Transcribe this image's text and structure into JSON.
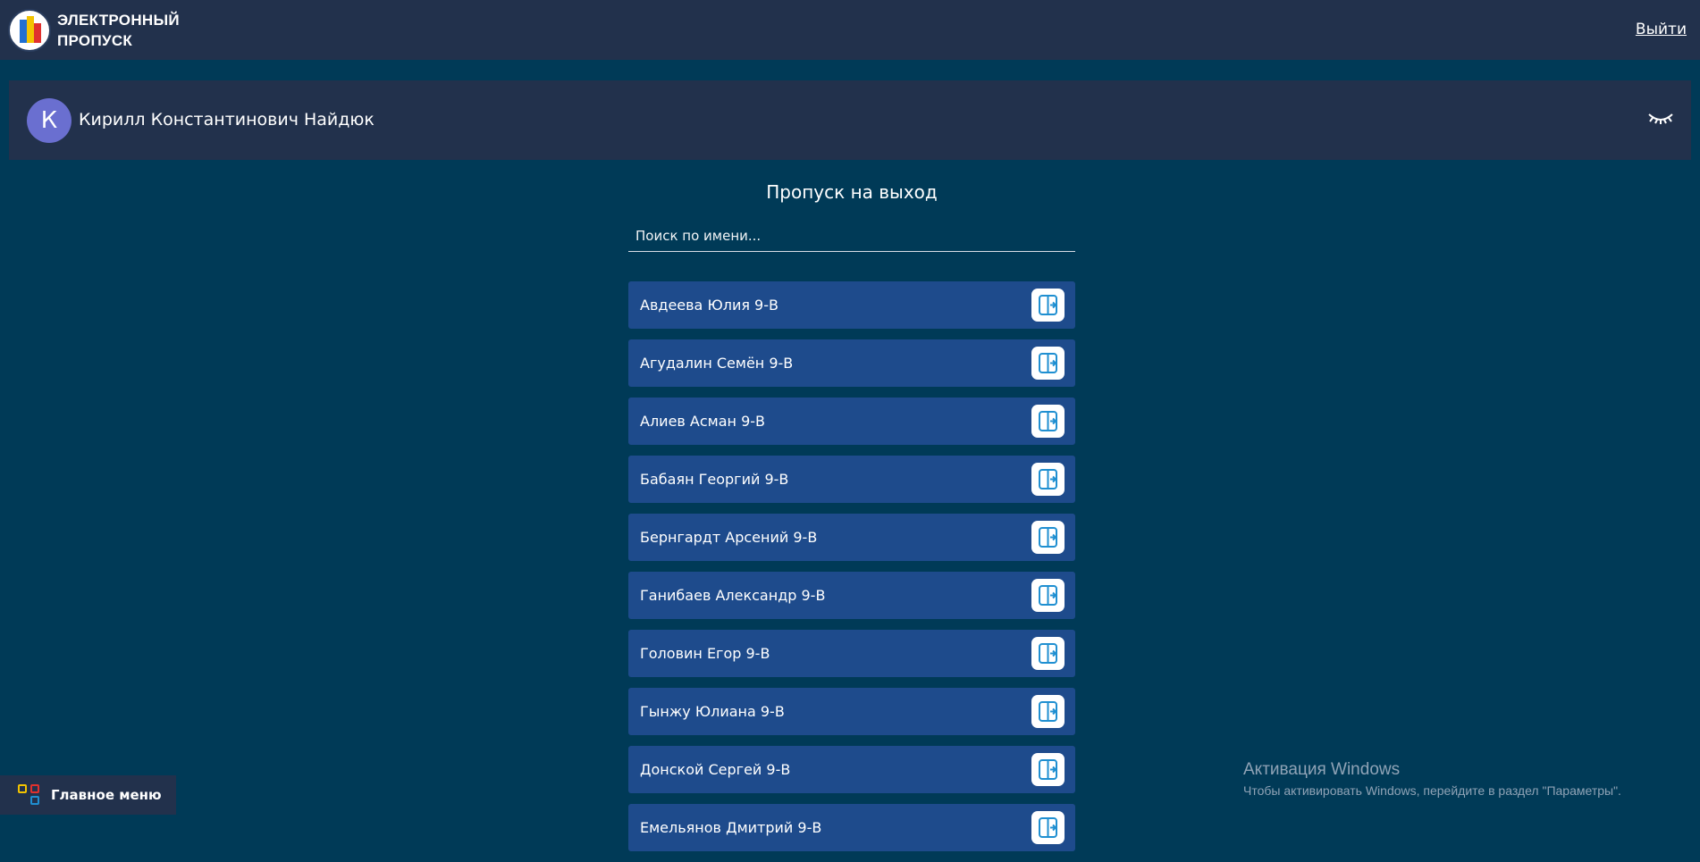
{
  "header": {
    "brand_line1": "ЭЛЕКТРОННЫЙ",
    "brand_line2": "ПРОПУСК",
    "logout": "Выйти"
  },
  "user": {
    "initial": "К",
    "name": "Кирилл Константинович Найдюк"
  },
  "main": {
    "title": "Пропуск на выход",
    "search_placeholder": "Поиск по имени...",
    "students": [
      "Авдеева Юлия 9-В",
      "Агудалин Семён 9-В",
      "Алиев Асман 9-В",
      "Бабаян Георгий 9-В",
      "Бернгардт Арсений 9-В",
      "Ганибаев Александр 9-В",
      "Головин Егор 9-В",
      "Гынжу Юлиана 9-В",
      "Донской Сергей 9-В",
      "Емельянов Дмитрий 9-В"
    ]
  },
  "menu": {
    "label": "Главное меню"
  },
  "watermark": {
    "title": "Активация Windows",
    "subtitle": "Чтобы активировать Windows, перейдите в раздел \"Параметры\"."
  },
  "colors": {
    "background": "#003a57",
    "panel": "#22314c",
    "list_item": "#1e4b8c",
    "avatar": "#6a6fd0",
    "icon_accent": "#1f8fd1"
  },
  "icons": {
    "logo": "school-logo-icon",
    "eye": "closed-eye-icon",
    "exit": "door-exit-icon",
    "menu": "grid-menu-icon"
  }
}
